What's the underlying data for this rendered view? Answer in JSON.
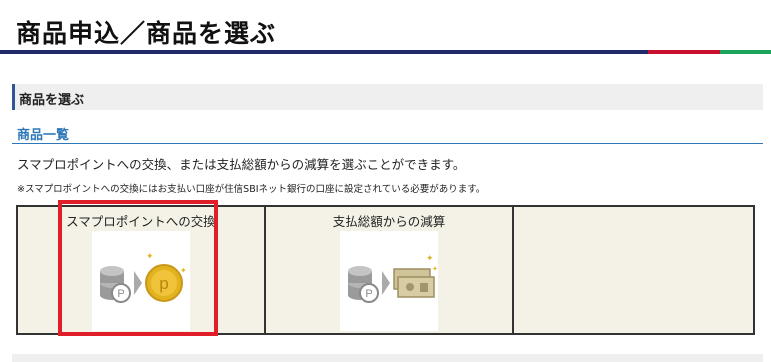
{
  "page": {
    "title": "商品申込／商品を選ぶ"
  },
  "section": {
    "header": "商品を選ぶ"
  },
  "subsection": {
    "heading": "商品一覧",
    "description": "スマプロポイントへの交換、または支払総額からの減算を選ぶことができます。",
    "note": "※スマプロポイントへの交換にはお支払い口座が住信SBIネット銀行の口座に設定されている必要があります。"
  },
  "options": [
    {
      "label": "スマプロポイントへの交換",
      "icon": "points-exchange-icon"
    },
    {
      "label": "支払総額からの減算",
      "icon": "payment-deduction-icon"
    },
    {
      "label": ""
    }
  ],
  "colors": {
    "title_rule": "#1f2a6b",
    "accent_red": "#c8102e",
    "accent_green": "#1aa35a",
    "heading_blue": "#2f78b8",
    "highlight": "#e01e2a",
    "table_bg": "#f4f2e6",
    "coin_gold": "#e3b21f"
  }
}
